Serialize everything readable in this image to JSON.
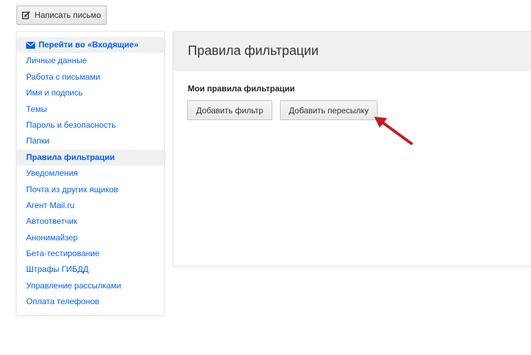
{
  "toolbar": {
    "compose_label": "Написать письмо",
    "compose_icon": "compose-icon"
  },
  "sidebar": {
    "items": [
      {
        "label": "Перейти во «Входящие»",
        "icon": "envelope-icon"
      },
      {
        "label": "Личные данные"
      },
      {
        "label": "Работа с письмами"
      },
      {
        "label": "Имя и подпись"
      },
      {
        "label": "Темы"
      },
      {
        "label": "Пароль и безопасность"
      },
      {
        "label": "Папки"
      },
      {
        "label": "Правила фильтрации",
        "active": true
      },
      {
        "label": "Уведомления"
      },
      {
        "label": "Почта из других ящиков"
      },
      {
        "label": "Агент Mail.ru"
      },
      {
        "label": "Автоответчик"
      },
      {
        "label": "Анонимайзер"
      },
      {
        "label": "Бета-тестирование"
      },
      {
        "label": "Штрафы ГИБДД"
      },
      {
        "label": "Управление рассылками"
      },
      {
        "label": "Оплата телефонов"
      }
    ]
  },
  "main": {
    "title": "Правила фильтрации",
    "section_title": "Мои правила фильтрации",
    "add_filter_label": "Добавить фильтр",
    "add_forward_label": "Добавить пересылку"
  },
  "colors": {
    "link": "#005ff9",
    "annotation_arrow": "#c8181e",
    "header_bg": "#f0f0f0"
  }
}
